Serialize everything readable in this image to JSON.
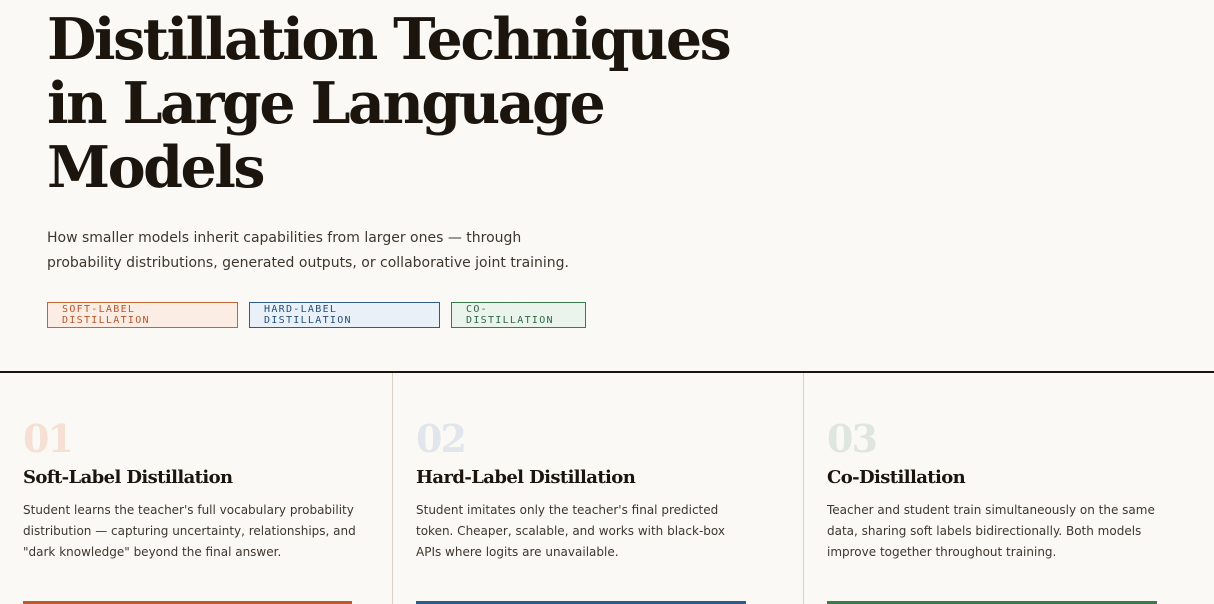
{
  "hero": {
    "title": "Distillation Techniques in Large Language Models",
    "subtitle": "How smaller models inherit capabilities from larger ones — through probability distributions, generated outputs, or collaborative joint training.",
    "tags": [
      {
        "label": "SOFT-LABEL DISTILLATION",
        "color": "#c46536"
      },
      {
        "label": "HARD-LABEL DISTILLATION",
        "color": "#2e5b8a"
      },
      {
        "label": "CO-DISTILLATION",
        "color": "#3a7a4c"
      }
    ]
  },
  "cards": [
    {
      "number": "01",
      "title": "Soft-Label Distillation",
      "description": "Student learns the teacher's full vocabulary probability distribution — capturing uncertainty, relationships, and \"dark knowledge\" beyond the final answer.",
      "accent": "#c0582e"
    },
    {
      "number": "02",
      "title": "Hard-Label Distillation",
      "description": "Student imitates only the teacher's final predicted token. Cheaper, scalable, and works with black-box APIs where logits are unavailable.",
      "accent": "#2c5a8b"
    },
    {
      "number": "03",
      "title": "Co-Distillation",
      "description": "Teacher and student train simultaneously on the same data, sharing soft labels bidirectionally. Both models improve together throughout training.",
      "accent": "#3a7a4c"
    }
  ]
}
